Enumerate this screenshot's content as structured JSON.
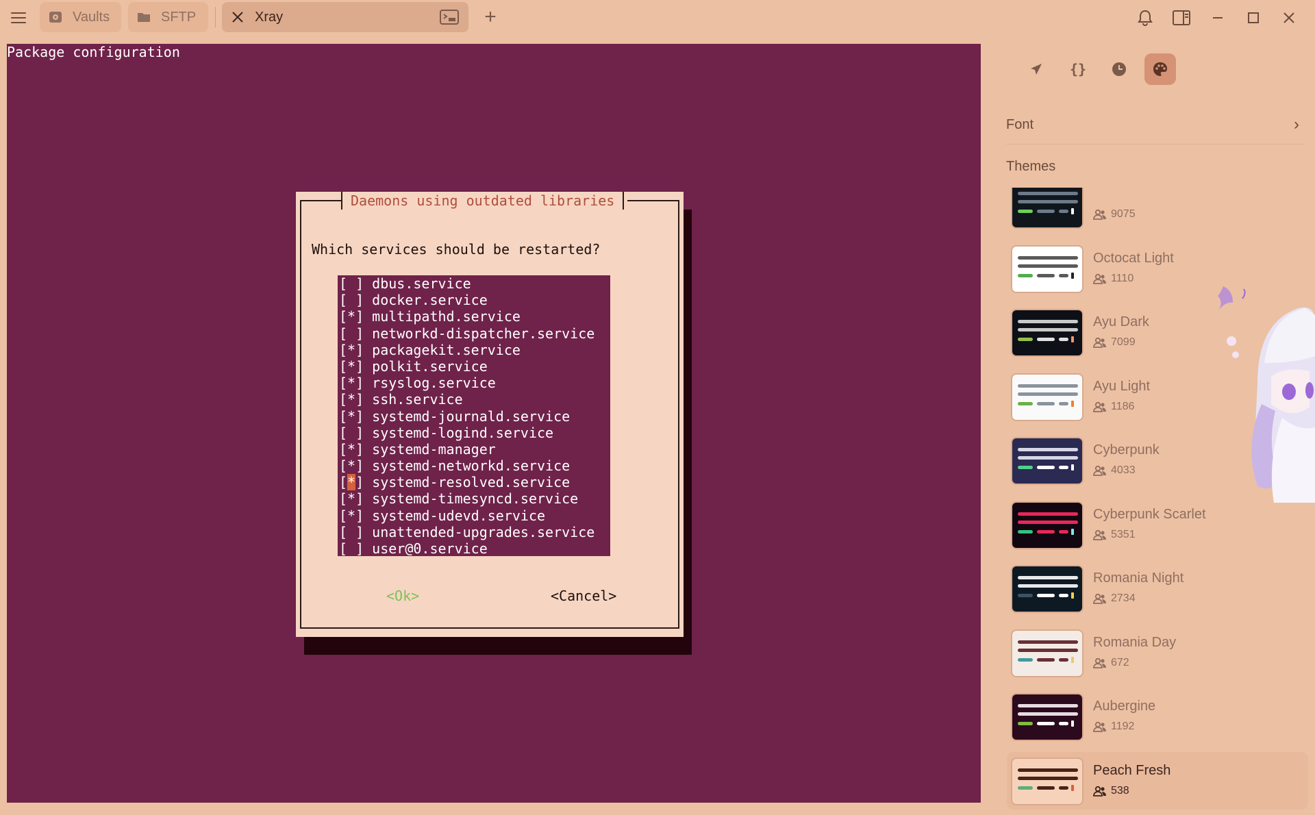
{
  "tabs": [
    {
      "label": "Vaults",
      "icon": "vault-icon"
    },
    {
      "label": "SFTP",
      "icon": "folder-icon"
    },
    {
      "label": "Xray",
      "icon": "close-icon",
      "active": true
    }
  ],
  "terminal": {
    "header": "Package configuration",
    "dialog": {
      "title": "Daemons using outdated libraries",
      "question": "Which services should be restarted?",
      "services": [
        {
          "mark": "[ ]",
          "name": "dbus.service"
        },
        {
          "mark": "[ ]",
          "name": "docker.service"
        },
        {
          "mark": "[*]",
          "name": "multipathd.service"
        },
        {
          "mark": "[ ]",
          "name": "networkd-dispatcher.service"
        },
        {
          "mark": "[*]",
          "name": "packagekit.service"
        },
        {
          "mark": "[*]",
          "name": "polkit.service"
        },
        {
          "mark": "[*]",
          "name": "rsyslog.service"
        },
        {
          "mark": "[*]",
          "name": "ssh.service"
        },
        {
          "mark": "[*]",
          "name": "systemd-journald.service"
        },
        {
          "mark": "[ ]",
          "name": "systemd-logind.service"
        },
        {
          "mark": "[*]",
          "name": "systemd-manager"
        },
        {
          "mark": "[*]",
          "name": "systemd-networkd.service"
        },
        {
          "mark": "[*]",
          "name": "systemd-resolved.service",
          "cursor": true
        },
        {
          "mark": "[*]",
          "name": "systemd-timesyncd.service"
        },
        {
          "mark": "[*]",
          "name": "systemd-udevd.service"
        },
        {
          "mark": "[ ]",
          "name": "unattended-upgrades.service"
        },
        {
          "mark": "[ ]",
          "name": "user@0.service"
        }
      ],
      "ok_label": "<Ok>",
      "cancel_label": "<Cancel>"
    }
  },
  "sidebar": {
    "tab_icons": [
      "rocket-icon",
      "braces-icon",
      "history-icon",
      "palette-icon"
    ],
    "font_label": "Font",
    "themes_label": "Themes",
    "themes": [
      {
        "name": "",
        "count": "9075",
        "bg": "#11161d",
        "line": "#6c7a89",
        "s1": "#6fcf5a",
        "s2": "#6c7a89",
        "s3": "#6c7a89",
        "s4": "#ffffff"
      },
      {
        "name": "Octocat Light",
        "count": "1110",
        "bg": "#ffffff",
        "line": "#5a5a5a",
        "s1": "#4fae4a",
        "s2": "#5a5a5a",
        "s3": "#5a5a5a",
        "s4": "#222222"
      },
      {
        "name": "Ayu Dark",
        "count": "7099",
        "bg": "#0d1017",
        "line": "#c9c9c9",
        "s1": "#94c04b",
        "s2": "#e0e0e0",
        "s3": "#e0e0e0",
        "s4": "#f29668"
      },
      {
        "name": "Ayu Light",
        "count": "1186",
        "bg": "#fafafa",
        "line": "#8a939d",
        "s1": "#6cb046",
        "s2": "#8a939d",
        "s3": "#8a939d",
        "s4": "#f07e2f"
      },
      {
        "name": "Cyberpunk",
        "count": "4033",
        "bg": "#2b2a52",
        "line": "#d7d7e8",
        "s1": "#4fd18b",
        "s2": "#ffffff",
        "s3": "#ffffff",
        "s4": "#ffffff"
      },
      {
        "name": "Cyberpunk Scarlet",
        "count": "5351",
        "bg": "#120610",
        "line": "#e8285a",
        "s1": "#35c27e",
        "s2": "#e8285a",
        "s3": "#e8285a",
        "s4": "#7ce7f0"
      },
      {
        "name": "Romania Night",
        "count": "2734",
        "bg": "#0d1a24",
        "line": "#e8e8e8",
        "s1": "#3b5464",
        "s2": "#ffffff",
        "s3": "#ffffff",
        "s4": "#f2d14b"
      },
      {
        "name": "Romania Day",
        "count": "672",
        "bg": "#f3ece6",
        "line": "#6a2e36",
        "s1": "#3f9d9b",
        "s2": "#6a2e36",
        "s3": "#6a2e36",
        "s4": "#e8c77a"
      },
      {
        "name": "Aubergine",
        "count": "1192",
        "bg": "#2b0a1e",
        "line": "#e8dbe2",
        "s1": "#7fbf3f",
        "s2": "#ffffff",
        "s3": "#ffffff",
        "s4": "#ffffff"
      },
      {
        "name": "Peach Fresh",
        "count": "538",
        "bg": "#f6d2bb",
        "line": "#4a2218",
        "s1": "#5fae7a",
        "s2": "#4a2218",
        "s3": "#4a2218",
        "s4": "#d5623b",
        "selected": true
      }
    ]
  }
}
